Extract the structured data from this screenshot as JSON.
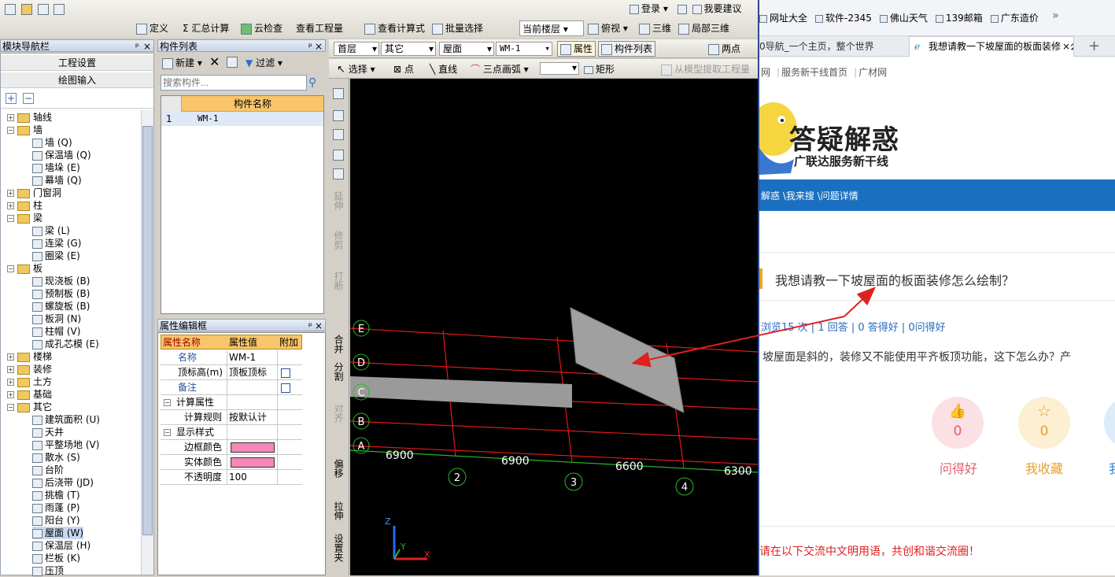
{
  "toolbar": {
    "login": "登录",
    "suggest": "我要建议",
    "define": "定义",
    "sum_calc": "Σ 汇总计算",
    "cloud_check": "云检查",
    "view_quantity": "查看工程量",
    "view_formula": "查看计算式",
    "batch_select": "批量选择",
    "current_floor": "当前楼层",
    "top_view": "俯视",
    "three_d": "三维",
    "local_3d": "局部三维"
  },
  "toolbar2": {
    "floor": "首层",
    "category": "其它",
    "subtype": "屋面",
    "component": "WM-1",
    "properties": "属性",
    "component_list": "构件列表",
    "two_points": "两点",
    "select": "选择",
    "point": "点",
    "line": "直线",
    "arc": "三点画弧",
    "rect": "矩形",
    "extract": "从模型提取工程量"
  },
  "nav": {
    "title": "模块导航栏",
    "project_settings": "工程设置",
    "draw_input": "绘图输入",
    "tree": [
      {
        "label": "轴线",
        "level": 0,
        "expanded": false
      },
      {
        "label": "墙",
        "level": 0,
        "expanded": true
      },
      {
        "label": "墙 (Q)",
        "level": 1
      },
      {
        "label": "保温墙 (Q)",
        "level": 1
      },
      {
        "label": "墙垛 (E)",
        "level": 1
      },
      {
        "label": "幕墙 (Q)",
        "level": 1
      },
      {
        "label": "门窗洞",
        "level": 0,
        "expanded": false
      },
      {
        "label": "柱",
        "level": 0,
        "expanded": false
      },
      {
        "label": "梁",
        "level": 0,
        "expanded": true
      },
      {
        "label": "梁 (L)",
        "level": 1
      },
      {
        "label": "连梁 (G)",
        "level": 1
      },
      {
        "label": "圈梁 (E)",
        "level": 1
      },
      {
        "label": "板",
        "level": 0,
        "expanded": true
      },
      {
        "label": "现浇板 (B)",
        "level": 1
      },
      {
        "label": "预制板 (B)",
        "level": 1
      },
      {
        "label": "螺旋板 (B)",
        "level": 1
      },
      {
        "label": "板洞 (N)",
        "level": 1
      },
      {
        "label": "柱帽 (V)",
        "level": 1
      },
      {
        "label": "成孔芯模 (E)",
        "level": 1
      },
      {
        "label": "楼梯",
        "level": 0,
        "expanded": false
      },
      {
        "label": "装修",
        "level": 0,
        "expanded": false
      },
      {
        "label": "土方",
        "level": 0,
        "expanded": false
      },
      {
        "label": "基础",
        "level": 0,
        "expanded": false
      },
      {
        "label": "其它",
        "level": 0,
        "expanded": true
      },
      {
        "label": "建筑面积 (U)",
        "level": 1
      },
      {
        "label": "天井",
        "level": 1
      },
      {
        "label": "平整场地 (V)",
        "level": 1
      },
      {
        "label": "散水 (S)",
        "level": 1
      },
      {
        "label": "台阶",
        "level": 1
      },
      {
        "label": "后浇带 (JD)",
        "level": 1
      },
      {
        "label": "挑檐 (T)",
        "level": 1
      },
      {
        "label": "雨蓬 (P)",
        "level": 1
      },
      {
        "label": "阳台 (Y)",
        "level": 1
      },
      {
        "label": "屋面 (W)",
        "level": 1,
        "selected": true
      },
      {
        "label": "保温层 (H)",
        "level": 1
      },
      {
        "label": "栏板 (K)",
        "level": 1
      },
      {
        "label": "压顶",
        "level": 1
      }
    ]
  },
  "component_list": {
    "title": "构件列表",
    "new": "新建",
    "filter": "过滤",
    "search_placeholder": "搜索构件...",
    "col_name": "构件名称",
    "rows": [
      {
        "num": "1",
        "name": "WM-1"
      }
    ]
  },
  "prop_editor": {
    "title": "属性编辑框",
    "col_name": "属性名称",
    "col_value": "属性值",
    "col_extra": "附加",
    "rows": [
      {
        "name": "名称",
        "value": "WM-1"
      },
      {
        "name": "顶标高(m)",
        "value": "顶板顶标"
      },
      {
        "name": "备注",
        "value": ""
      },
      {
        "name": "计算属性",
        "value": ""
      },
      {
        "name": "计算规则",
        "value": "按默认计"
      },
      {
        "name": "显示样式",
        "value": ""
      },
      {
        "name": "边框颜色",
        "value": ""
      },
      {
        "name": "实体颜色",
        "value": ""
      },
      {
        "name": "不透明度",
        "value": "100"
      }
    ]
  },
  "vtools": [
    "延伸",
    "修剪",
    "打断",
    "合并",
    "分割",
    "对齐",
    "偏移",
    "拉伸",
    "设置夹"
  ],
  "canvas": {
    "axes": [
      "E",
      "D",
      "C",
      "B",
      "A"
    ],
    "cols": [
      "2",
      "3",
      "4"
    ],
    "dims": [
      "6900",
      "6900",
      "6600",
      "6300"
    ],
    "z": "Z",
    "y": "Y",
    "x": "X"
  },
  "browser": {
    "favs": [
      "网址大全",
      "软件-2345",
      "佛山天气",
      "139邮箱",
      "广东造价"
    ],
    "tab1": "0导航_一个主页，整个世界",
    "tab2": "我想请教一下坡屋面的板面装修怎么",
    "nav_links": [
      "网",
      "服务新干线首页",
      "广材网"
    ],
    "logo_title": "答疑解惑",
    "logo_sub": "广联达服务新干线",
    "breadcrumb": "解惑 \\我来搜 \\问题详情",
    "question": "我想请教一下坡屋面的板面装修怎么绘制？",
    "stats": "浏览15 次 | 1 回答 | 0 答得好 | 0问得好",
    "body": "坡屋面是斜的，装修又不能使用平齐板顶功能，这下怎么办？产",
    "btn_good": "问得好",
    "btn_good_count": "0",
    "btn_fav": "我收藏",
    "btn_fav_count": "0",
    "btn_partial": "我",
    "footer_note": "请在以下交流中文明用语，共创和谐交流圈！"
  },
  "colors": {
    "pink": "#f588b8",
    "accent_blue": "#1a6fc0",
    "arrow_red": "#e02020"
  }
}
